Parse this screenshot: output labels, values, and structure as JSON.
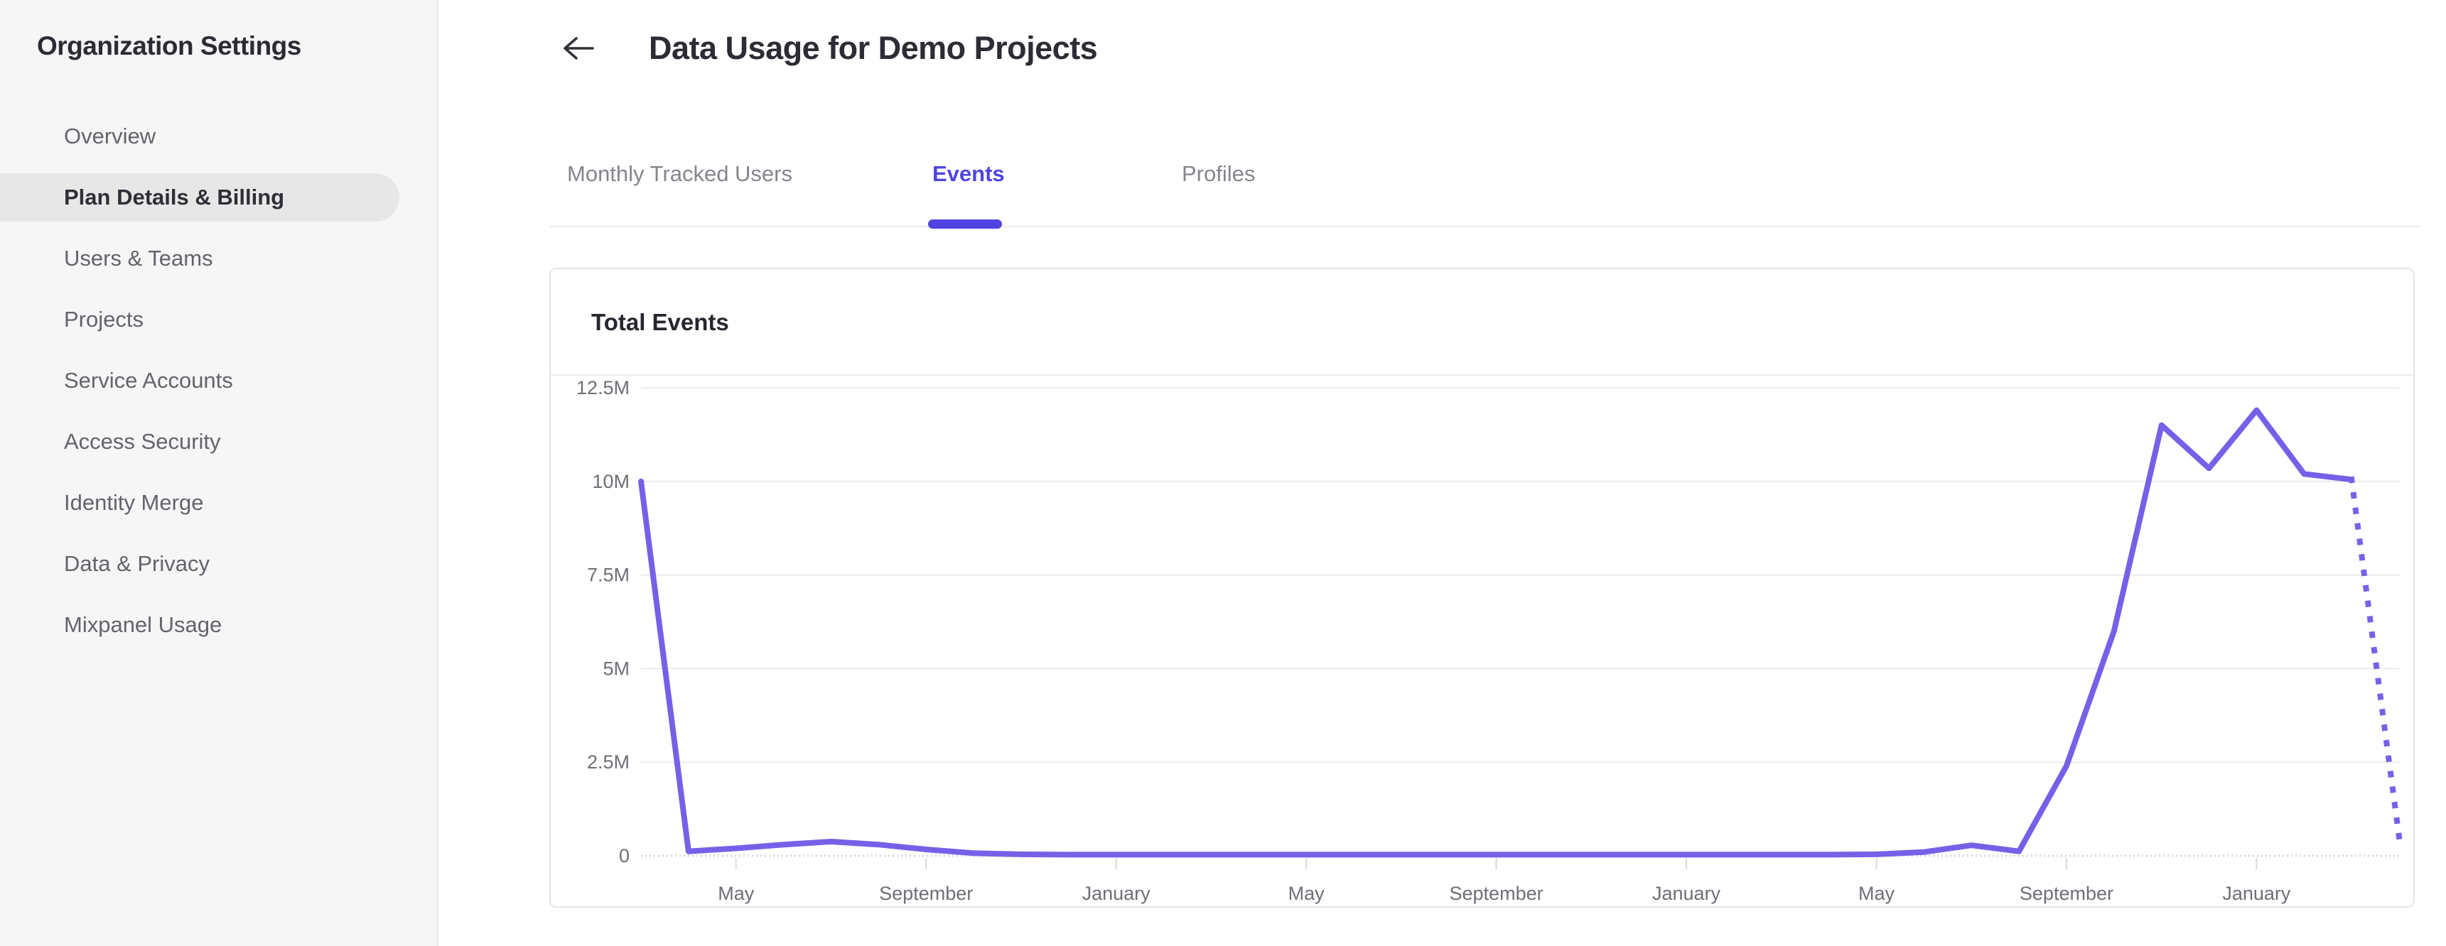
{
  "sidebar": {
    "title": "Organization Settings",
    "items": [
      {
        "label": "Overview",
        "active": false
      },
      {
        "label": "Plan Details & Billing",
        "active": true
      },
      {
        "label": "Users & Teams",
        "active": false
      },
      {
        "label": "Projects",
        "active": false
      },
      {
        "label": "Service Accounts",
        "active": false
      },
      {
        "label": "Access Security",
        "active": false
      },
      {
        "label": "Identity Merge",
        "active": false
      },
      {
        "label": "Data & Privacy",
        "active": false
      },
      {
        "label": "Mixpanel Usage",
        "active": false
      }
    ]
  },
  "header": {
    "back_icon": "left-arrow",
    "title": "Data Usage for Demo Projects"
  },
  "tabs": [
    {
      "label": "Monthly Tracked Users",
      "active": false,
      "left": 798
    },
    {
      "label": "Events",
      "active": true,
      "left": 1312
    },
    {
      "label": "Profiles",
      "active": false,
      "left": 1663
    }
  ],
  "card": {
    "title": "Total Events"
  },
  "colors": {
    "accent": "#4f44e0",
    "line": "#7561e8",
    "grid": "#ebebed",
    "baseline": "#d6d6d9",
    "tick": "#d9d9dc",
    "axis_text": "#6e6e76"
  },
  "chart_data": {
    "type": "line",
    "title": "Total Events",
    "xlabel": "",
    "ylabel": "",
    "legend": "none",
    "grid": "horizontal",
    "ylim": [
      0,
      12.5
    ],
    "y_ticks": [
      {
        "value": 0,
        "label": "0"
      },
      {
        "value": 2.5,
        "label": "2.5M"
      },
      {
        "value": 5,
        "label": "5M"
      },
      {
        "value": 7.5,
        "label": "7.5M"
      },
      {
        "value": 10,
        "label": "10M"
      },
      {
        "value": 12.5,
        "label": "12.5M"
      }
    ],
    "x_ticks": [
      {
        "index": 2,
        "label": "May"
      },
      {
        "index": 6,
        "label": "September"
      },
      {
        "index": 10,
        "label": "January"
      },
      {
        "index": 14,
        "label": "May"
      },
      {
        "index": 18,
        "label": "September"
      },
      {
        "index": 22,
        "label": "January"
      },
      {
        "index": 26,
        "label": "May"
      },
      {
        "index": 30,
        "label": "September"
      },
      {
        "index": 34,
        "label": "January"
      }
    ],
    "unit": "events, millions (monthly points)",
    "values_millions": [
      10,
      0.12,
      0.2,
      0.3,
      0.38,
      0.3,
      0.17,
      0.07,
      0.04,
      0.03,
      0.03,
      0.03,
      0.03,
      0.03,
      0.03,
      0.03,
      0.03,
      0.03,
      0.03,
      0.03,
      0.03,
      0.03,
      0.03,
      0.03,
      0.03,
      0.03,
      0.04,
      0.1,
      0.28,
      0.12,
      2.4,
      6.0,
      11.5,
      10.35,
      11.9,
      10.2,
      10.05,
      0.5
    ],
    "solid_until_index": 36,
    "projected_last_segment_dotted": true
  }
}
